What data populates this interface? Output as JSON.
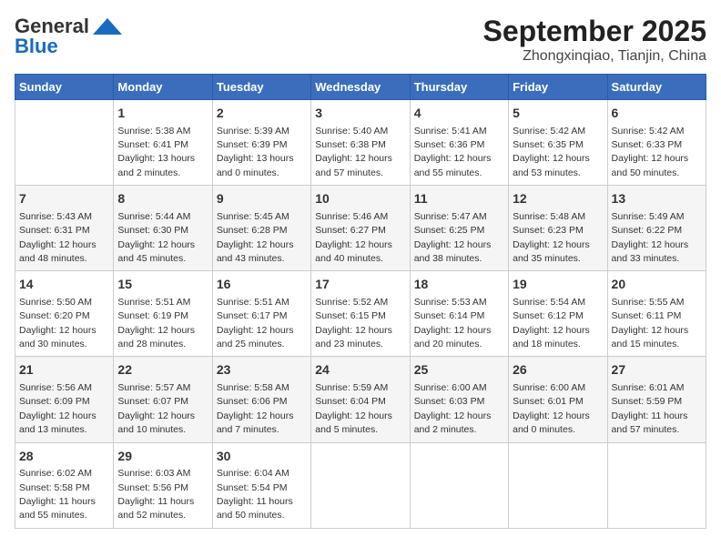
{
  "header": {
    "logo_line1": "General",
    "logo_line2": "Blue",
    "month_title": "September 2025",
    "location": "Zhongxinqiao, Tianjin, China"
  },
  "weekdays": [
    "Sunday",
    "Monday",
    "Tuesday",
    "Wednesday",
    "Thursday",
    "Friday",
    "Saturday"
  ],
  "weeks": [
    [
      {
        "day": "",
        "info": ""
      },
      {
        "day": "1",
        "info": "Sunrise: 5:38 AM\nSunset: 6:41 PM\nDaylight: 13 hours\nand 2 minutes."
      },
      {
        "day": "2",
        "info": "Sunrise: 5:39 AM\nSunset: 6:39 PM\nDaylight: 13 hours\nand 0 minutes."
      },
      {
        "day": "3",
        "info": "Sunrise: 5:40 AM\nSunset: 6:38 PM\nDaylight: 12 hours\nand 57 minutes."
      },
      {
        "day": "4",
        "info": "Sunrise: 5:41 AM\nSunset: 6:36 PM\nDaylight: 12 hours\nand 55 minutes."
      },
      {
        "day": "5",
        "info": "Sunrise: 5:42 AM\nSunset: 6:35 PM\nDaylight: 12 hours\nand 53 minutes."
      },
      {
        "day": "6",
        "info": "Sunrise: 5:42 AM\nSunset: 6:33 PM\nDaylight: 12 hours\nand 50 minutes."
      }
    ],
    [
      {
        "day": "7",
        "info": "Sunrise: 5:43 AM\nSunset: 6:31 PM\nDaylight: 12 hours\nand 48 minutes."
      },
      {
        "day": "8",
        "info": "Sunrise: 5:44 AM\nSunset: 6:30 PM\nDaylight: 12 hours\nand 45 minutes."
      },
      {
        "day": "9",
        "info": "Sunrise: 5:45 AM\nSunset: 6:28 PM\nDaylight: 12 hours\nand 43 minutes."
      },
      {
        "day": "10",
        "info": "Sunrise: 5:46 AM\nSunset: 6:27 PM\nDaylight: 12 hours\nand 40 minutes."
      },
      {
        "day": "11",
        "info": "Sunrise: 5:47 AM\nSunset: 6:25 PM\nDaylight: 12 hours\nand 38 minutes."
      },
      {
        "day": "12",
        "info": "Sunrise: 5:48 AM\nSunset: 6:23 PM\nDaylight: 12 hours\nand 35 minutes."
      },
      {
        "day": "13",
        "info": "Sunrise: 5:49 AM\nSunset: 6:22 PM\nDaylight: 12 hours\nand 33 minutes."
      }
    ],
    [
      {
        "day": "14",
        "info": "Sunrise: 5:50 AM\nSunset: 6:20 PM\nDaylight: 12 hours\nand 30 minutes."
      },
      {
        "day": "15",
        "info": "Sunrise: 5:51 AM\nSunset: 6:19 PM\nDaylight: 12 hours\nand 28 minutes."
      },
      {
        "day": "16",
        "info": "Sunrise: 5:51 AM\nSunset: 6:17 PM\nDaylight: 12 hours\nand 25 minutes."
      },
      {
        "day": "17",
        "info": "Sunrise: 5:52 AM\nSunset: 6:15 PM\nDaylight: 12 hours\nand 23 minutes."
      },
      {
        "day": "18",
        "info": "Sunrise: 5:53 AM\nSunset: 6:14 PM\nDaylight: 12 hours\nand 20 minutes."
      },
      {
        "day": "19",
        "info": "Sunrise: 5:54 AM\nSunset: 6:12 PM\nDaylight: 12 hours\nand 18 minutes."
      },
      {
        "day": "20",
        "info": "Sunrise: 5:55 AM\nSunset: 6:11 PM\nDaylight: 12 hours\nand 15 minutes."
      }
    ],
    [
      {
        "day": "21",
        "info": "Sunrise: 5:56 AM\nSunset: 6:09 PM\nDaylight: 12 hours\nand 13 minutes."
      },
      {
        "day": "22",
        "info": "Sunrise: 5:57 AM\nSunset: 6:07 PM\nDaylight: 12 hours\nand 10 minutes."
      },
      {
        "day": "23",
        "info": "Sunrise: 5:58 AM\nSunset: 6:06 PM\nDaylight: 12 hours\nand 7 minutes."
      },
      {
        "day": "24",
        "info": "Sunrise: 5:59 AM\nSunset: 6:04 PM\nDaylight: 12 hours\nand 5 minutes."
      },
      {
        "day": "25",
        "info": "Sunrise: 6:00 AM\nSunset: 6:03 PM\nDaylight: 12 hours\nand 2 minutes."
      },
      {
        "day": "26",
        "info": "Sunrise: 6:00 AM\nSunset: 6:01 PM\nDaylight: 12 hours\nand 0 minutes."
      },
      {
        "day": "27",
        "info": "Sunrise: 6:01 AM\nSunset: 5:59 PM\nDaylight: 11 hours\nand 57 minutes."
      }
    ],
    [
      {
        "day": "28",
        "info": "Sunrise: 6:02 AM\nSunset: 5:58 PM\nDaylight: 11 hours\nand 55 minutes."
      },
      {
        "day": "29",
        "info": "Sunrise: 6:03 AM\nSunset: 5:56 PM\nDaylight: 11 hours\nand 52 minutes."
      },
      {
        "day": "30",
        "info": "Sunrise: 6:04 AM\nSunset: 5:54 PM\nDaylight: 11 hours\nand 50 minutes."
      },
      {
        "day": "",
        "info": ""
      },
      {
        "day": "",
        "info": ""
      },
      {
        "day": "",
        "info": ""
      },
      {
        "day": "",
        "info": ""
      }
    ]
  ]
}
